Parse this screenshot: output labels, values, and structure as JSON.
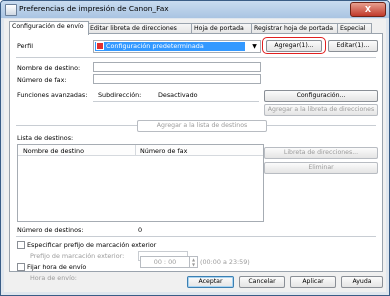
{
  "window": {
    "title": "Preferencias de impresión de Canon_Fax",
    "close": "X"
  },
  "tabs": [
    {
      "label": "Configuración de envío"
    },
    {
      "label": "Editar libreta de direcciones"
    },
    {
      "label": "Hoja de portada"
    },
    {
      "label": "Registrar hoja de portada"
    },
    {
      "label": "Especial"
    }
  ],
  "profile": {
    "label": "Perfil",
    "selected": "Configuración predeterminada",
    "add_button": "Agregar(1)...",
    "edit_button": "Editar(1)..."
  },
  "form": {
    "dest_name_label": "Nombre de destino:",
    "fax_label": "Número de fax:",
    "advanced_label": "Funciones avanzadas:",
    "subaddress_label": "Subdirección:",
    "subaddress_value": "Desactivado",
    "config_button": "Configuración...",
    "add_addressbook_button": "Agregar a la libreta de direcciones",
    "add_list_button": "Agregar a la lista de destinos"
  },
  "destinations": {
    "label": "Lista de destinos:",
    "col_name": "Nombre de destino",
    "col_fax": "Número de fax",
    "addressbook_button": "Libreta de direcciones...",
    "delete_button": "Eliminar",
    "count_label": "Número de destinos:",
    "count_value": "0"
  },
  "options": {
    "prefix_check": "Especificar prefijo de marcación exterior",
    "prefix_label": "Prefijo de marcación exterior:",
    "time_check": "Fijar hora de envío",
    "time_label": "Hora de envío:",
    "time_value": "00 : 00",
    "time_range": "(00:00 a 23:59)"
  },
  "footer": {
    "ok": "Aceptar",
    "cancel": "Cancelar",
    "apply": "Aplicar",
    "help": "Ayuda"
  }
}
